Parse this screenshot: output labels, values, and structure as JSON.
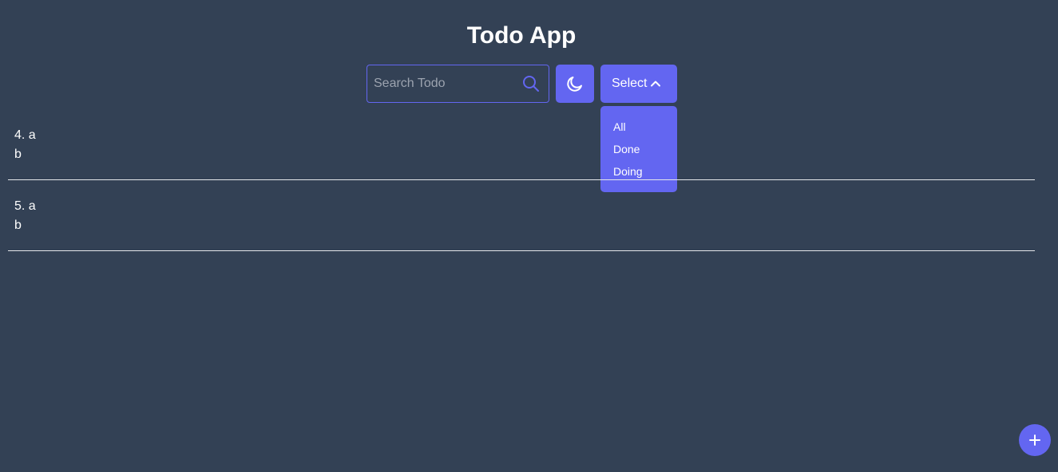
{
  "app": {
    "title": "Todo App"
  },
  "search": {
    "placeholder": "Search Todo",
    "value": "",
    "icon": "search-icon"
  },
  "theme_toggle": {
    "icon": "moon-icon"
  },
  "filter": {
    "label": "Select",
    "icon": "chevron-up-icon",
    "options": [
      "All",
      "Done",
      "Doing"
    ]
  },
  "todos": [
    {
      "title": "4. a",
      "description": "b"
    },
    {
      "title": "5. a",
      "description": "b"
    }
  ],
  "add_button": {
    "icon": "plus-icon"
  },
  "colors": {
    "background": "#334155",
    "accent": "#6366f1",
    "text": "#ffffff",
    "divider": "#e5e7eb"
  }
}
